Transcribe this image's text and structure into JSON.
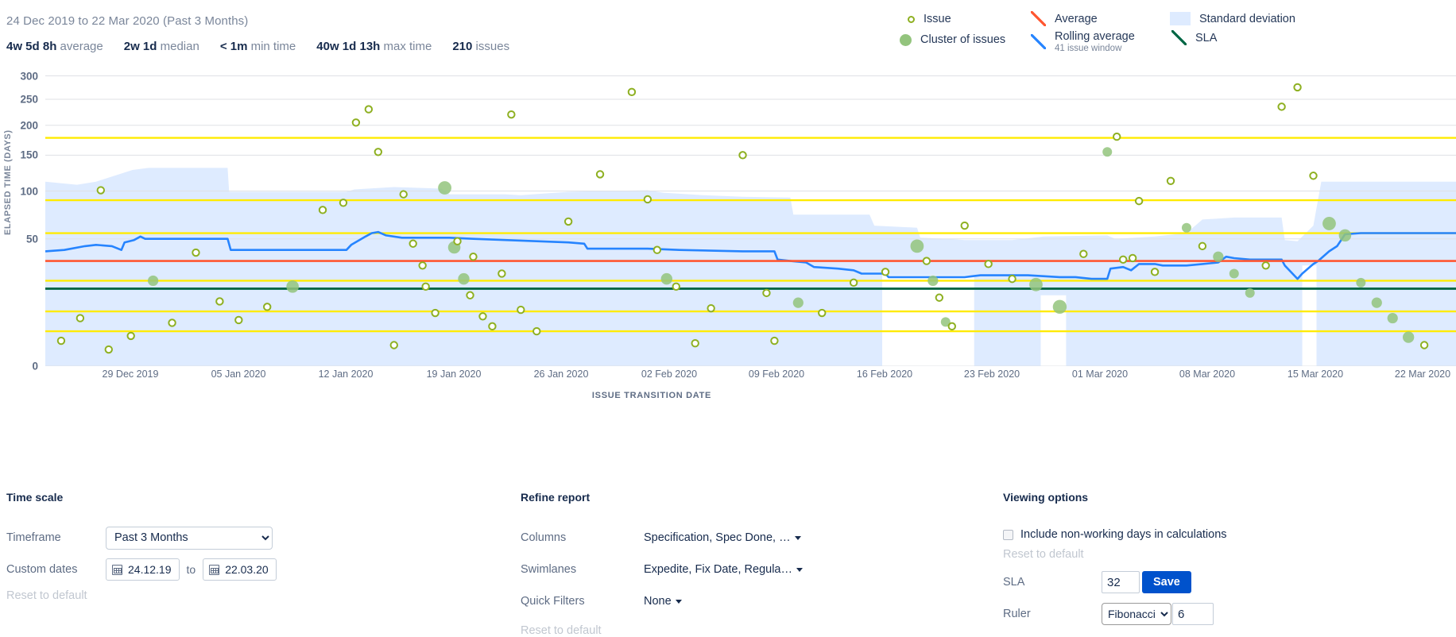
{
  "header": {
    "date_range": "24 Dec 2019 to 22 Mar 2020 (Past 3 Months)",
    "stats": [
      {
        "value": "4w 5d 8h",
        "label": "average"
      },
      {
        "value": "2w 1d",
        "label": "median"
      },
      {
        "value": "< 1m",
        "label": "min time"
      },
      {
        "value": "40w 1d 13h",
        "label": "max time"
      },
      {
        "value": "210",
        "label": "issues"
      }
    ]
  },
  "legend": [
    {
      "name": "issue",
      "label": "Issue",
      "sub": "",
      "marker": "circle-outline",
      "color": "#8eb021"
    },
    {
      "name": "cluster",
      "label": "Cluster of issues",
      "sub": "",
      "marker": "circle-filled",
      "color": "#93c47d"
    },
    {
      "name": "average",
      "label": "Average",
      "sub": "",
      "marker": "line",
      "color": "#ff5630"
    },
    {
      "name": "rolling-average",
      "label": "Rolling average",
      "sub": "41 issue window",
      "marker": "line",
      "color": "#2684ff"
    },
    {
      "name": "standard-deviation",
      "label": "Standard deviation",
      "sub": "",
      "marker": "band",
      "color": "#deebff"
    },
    {
      "name": "sla",
      "label": "SLA",
      "sub": "",
      "marker": "line",
      "color": "#006644"
    }
  ],
  "chart_data": {
    "type": "scatter",
    "title": "",
    "xlabel": "ISSUE TRANSITION DATE",
    "ylabel": "ELAPSED TIME (DAYS)",
    "yticks": [
      0,
      50,
      100,
      150,
      200,
      250,
      300
    ],
    "ylim": [
      0,
      310
    ],
    "xticks": [
      "29 Dec 2019",
      "05 Jan 2020",
      "12 Jan 2020",
      "19 Jan 2020",
      "26 Jan 2020",
      "02 Feb 2020",
      "09 Feb 2020",
      "16 Feb 2020",
      "23 Feb 2020",
      "01 Mar 2020",
      "08 Mar 2020",
      "15 Mar 2020",
      "22 Mar 2020"
    ],
    "xlim": [
      "24 Dec 2019",
      "22 Mar 2020"
    ],
    "grid": true,
    "legend_position": "top-right",
    "average_value": 33,
    "sla_value": 32,
    "ruler_type": "Fibonacci",
    "ruler_count": 6,
    "ruler_values": [
      3,
      8,
      21,
      55,
      89,
      178
    ],
    "issues": [
      {
        "x": 1.0,
        "y": 1.5,
        "cluster": false
      },
      {
        "x": 2.2,
        "y": 6.0,
        "cluster": false
      },
      {
        "x": 3.5,
        "y": 101,
        "cluster": false
      },
      {
        "x": 4.0,
        "y": 0.6,
        "cluster": false
      },
      {
        "x": 5.4,
        "y": 2.2,
        "cluster": false
      },
      {
        "x": 6.8,
        "y": 21.0,
        "cluster": true
      },
      {
        "x": 8.0,
        "y": 4.8,
        "cluster": false
      },
      {
        "x": 9.5,
        "y": 39.0,
        "cluster": false
      },
      {
        "x": 11.0,
        "y": 11.5,
        "cluster": false
      },
      {
        "x": 12.2,
        "y": 5.5,
        "cluster": false
      },
      {
        "x": 14.0,
        "y": 9.5,
        "cluster": false
      },
      {
        "x": 15.6,
        "y": 18.0,
        "cluster": true
      },
      {
        "x": 17.5,
        "y": 78.0,
        "cluster": false
      },
      {
        "x": 18.8,
        "y": 86.0,
        "cluster": false
      },
      {
        "x": 19.6,
        "y": 205,
        "cluster": false
      },
      {
        "x": 20.4,
        "y": 230,
        "cluster": false
      },
      {
        "x": 21.0,
        "y": 155,
        "cluster": false
      },
      {
        "x": 22.0,
        "y": 1.0,
        "cluster": false
      },
      {
        "x": 22.6,
        "y": 96.0,
        "cluster": false
      },
      {
        "x": 23.2,
        "y": 46.0,
        "cluster": false
      },
      {
        "x": 23.8,
        "y": 30.0,
        "cluster": false
      },
      {
        "x": 24.0,
        "y": 18.0,
        "cluster": false
      },
      {
        "x": 24.6,
        "y": 7.5,
        "cluster": false
      },
      {
        "x": 25.2,
        "y": 104,
        "cluster": true
      },
      {
        "x": 25.8,
        "y": 43.0,
        "cluster": true
      },
      {
        "x": 26.0,
        "y": 48.0,
        "cluster": false
      },
      {
        "x": 26.4,
        "y": 22.0,
        "cluster": true
      },
      {
        "x": 26.8,
        "y": 14.0,
        "cluster": false
      },
      {
        "x": 27.0,
        "y": 36.0,
        "cluster": false
      },
      {
        "x": 27.6,
        "y": 6.5,
        "cluster": false
      },
      {
        "x": 28.2,
        "y": 4.0,
        "cluster": false
      },
      {
        "x": 28.8,
        "y": 25.0,
        "cluster": false
      },
      {
        "x": 29.4,
        "y": 220,
        "cluster": false
      },
      {
        "x": 30.0,
        "y": 8.5,
        "cluster": false
      },
      {
        "x": 31.0,
        "y": 3.0,
        "cluster": false
      },
      {
        "x": 33.0,
        "y": 66.0,
        "cluster": false
      },
      {
        "x": 35.0,
        "y": 122,
        "cluster": false
      },
      {
        "x": 37.0,
        "y": 265,
        "cluster": false
      },
      {
        "x": 38.0,
        "y": 90.0,
        "cluster": false
      },
      {
        "x": 38.6,
        "y": 41.0,
        "cluster": false
      },
      {
        "x": 39.2,
        "y": 22.0,
        "cluster": true
      },
      {
        "x": 39.8,
        "y": 18.0,
        "cluster": false
      },
      {
        "x": 41.0,
        "y": 1.2,
        "cluster": false
      },
      {
        "x": 42.0,
        "y": 9.0,
        "cluster": false
      },
      {
        "x": 44.0,
        "y": 150,
        "cluster": false
      },
      {
        "x": 45.5,
        "y": 15.0,
        "cluster": false
      },
      {
        "x": 46.0,
        "y": 1.5,
        "cluster": false
      },
      {
        "x": 47.5,
        "y": 11.0,
        "cluster": true
      },
      {
        "x": 49.0,
        "y": 7.5,
        "cluster": false
      },
      {
        "x": 51.0,
        "y": 20.0,
        "cluster": false
      },
      {
        "x": 53.0,
        "y": 26.0,
        "cluster": false
      },
      {
        "x": 55.0,
        "y": 44.0,
        "cluster": true
      },
      {
        "x": 55.6,
        "y": 33.0,
        "cluster": false
      },
      {
        "x": 56.0,
        "y": 21.0,
        "cluster": true
      },
      {
        "x": 56.4,
        "y": 13.0,
        "cluster": false
      },
      {
        "x": 56.8,
        "y": 5.0,
        "cluster": true
      },
      {
        "x": 57.2,
        "y": 4.0,
        "cluster": false
      },
      {
        "x": 58.0,
        "y": 62.0,
        "cluster": false
      },
      {
        "x": 59.5,
        "y": 31.0,
        "cluster": false
      },
      {
        "x": 61.0,
        "y": 22.0,
        "cluster": false
      },
      {
        "x": 62.5,
        "y": 19.0,
        "cluster": true
      },
      {
        "x": 64.0,
        "y": 9.5,
        "cluster": true
      },
      {
        "x": 65.5,
        "y": 38.0,
        "cluster": false
      },
      {
        "x": 67.0,
        "y": 155,
        "cluster": true
      },
      {
        "x": 67.6,
        "y": 180,
        "cluster": false
      },
      {
        "x": 68.0,
        "y": 34.0,
        "cluster": false
      },
      {
        "x": 68.6,
        "y": 35.0,
        "cluster": false
      },
      {
        "x": 69.0,
        "y": 88.0,
        "cluster": false
      },
      {
        "x": 70.0,
        "y": 26.0,
        "cluster": false
      },
      {
        "x": 71.0,
        "y": 113,
        "cluster": false
      },
      {
        "x": 72.0,
        "y": 60.0,
        "cluster": true
      },
      {
        "x": 73.0,
        "y": 44.0,
        "cluster": false
      },
      {
        "x": 74.0,
        "y": 36.0,
        "cluster": true
      },
      {
        "x": 75.0,
        "y": 25.0,
        "cluster": true
      },
      {
        "x": 76.0,
        "y": 15.0,
        "cluster": true
      },
      {
        "x": 77.0,
        "y": 30.0,
        "cluster": false
      },
      {
        "x": 78.0,
        "y": 235,
        "cluster": false
      },
      {
        "x": 79.0,
        "y": 275,
        "cluster": false
      },
      {
        "x": 80.0,
        "y": 120,
        "cluster": false
      },
      {
        "x": 81.0,
        "y": 64.0,
        "cluster": true
      },
      {
        "x": 82.0,
        "y": 53.0,
        "cluster": true
      },
      {
        "x": 83.0,
        "y": 20.0,
        "cluster": true
      },
      {
        "x": 84.0,
        "y": 11.0,
        "cluster": true
      },
      {
        "x": 85.0,
        "y": 6.0,
        "cluster": true
      },
      {
        "x": 86.0,
        "y": 2.0,
        "cluster": true
      },
      {
        "x": 87.0,
        "y": 1.0,
        "cluster": false
      }
    ]
  },
  "panel": {
    "time_scale": {
      "title": "Time scale",
      "timeframe_label": "Timeframe",
      "timeframe_value": "Past 3 Months",
      "timeframe_options": [
        "Past 3 Months"
      ],
      "custom_dates_label": "Custom dates",
      "date_from": "24.12.19",
      "date_to": "22.03.20",
      "to_label": "to",
      "reset_label": "Reset to default"
    },
    "refine_report": {
      "title": "Refine report",
      "columns_label": "Columns",
      "columns_value": "Specification, Spec Done, …",
      "swimlanes_label": "Swimlanes",
      "swimlanes_value": "Expedite, Fix Date, Regula…",
      "quick_filters_label": "Quick Filters",
      "quick_filters_value": "None",
      "reset_label": "Reset to default"
    },
    "viewing_options": {
      "title": "Viewing options",
      "non_working_label": "Include non-working days in calculations",
      "non_working_checked": false,
      "reset_label": "Reset to default",
      "sla_label": "SLA",
      "sla_value": "32",
      "save_label": "Save",
      "ruler_label": "Ruler",
      "ruler_type": "Fibonacci",
      "ruler_options": [
        "Fibonacci"
      ],
      "ruler_value": "6"
    }
  }
}
